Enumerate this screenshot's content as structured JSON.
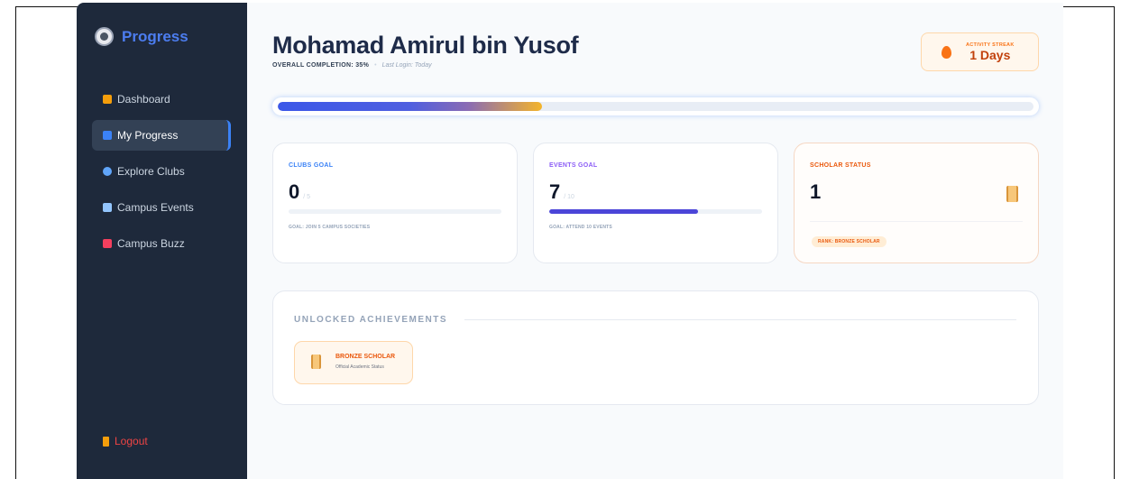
{
  "sidebar": {
    "brand": "Progress",
    "items": [
      {
        "label": "Dashboard",
        "icon": "house-icon",
        "color": "#f59e0b",
        "active": false
      },
      {
        "label": "My Progress",
        "icon": "bar-chart-icon",
        "color": "#3b82f6",
        "active": true
      },
      {
        "label": "Explore Clubs",
        "icon": "magnifier-icon",
        "color": "#60a5fa",
        "active": false
      },
      {
        "label": "Campus Events",
        "icon": "calendar-icon",
        "color": "#93c5fd",
        "active": false
      },
      {
        "label": "Campus Buzz",
        "icon": "megaphone-icon",
        "color": "#f43f5e",
        "active": false
      }
    ],
    "logout": "Logout"
  },
  "header": {
    "name": "Mohamad Amirul bin Yusof",
    "completion": "OVERALL COMPLETION: 35%",
    "separator": "•",
    "last_login": "Last Login: Today",
    "streak_label": "ACTIVITY STREAK",
    "streak_value": "1 Days"
  },
  "progress": {
    "percent": 35
  },
  "cards": {
    "clubs": {
      "label": "CLUBS GOAL",
      "value": "0",
      "of": "/ 5",
      "goal": "GOAL: JOIN 5 CAMPUS SOCIETIES",
      "fraction": 0,
      "label_color": "#3b82f6"
    },
    "events": {
      "label": "EVENTS GOAL",
      "value": "7",
      "of": "/ 10",
      "goal": "GOAL: ATTEND 10 EVENTS",
      "fraction": 0.7,
      "label_color": "#8b5cf6"
    },
    "scholar": {
      "label": "SCHOLAR STATUS",
      "value": "1",
      "rank": "RANK: BRONZE SCHOLAR",
      "icon": "scroll-icon",
      "label_color": "#ea580c"
    }
  },
  "achievements": {
    "title": "UNLOCKED ACHIEVEMENTS",
    "items": [
      {
        "name": "BRONZE SCHOLAR",
        "description": "Official Academic Status",
        "icon": "scroll-icon"
      }
    ]
  }
}
